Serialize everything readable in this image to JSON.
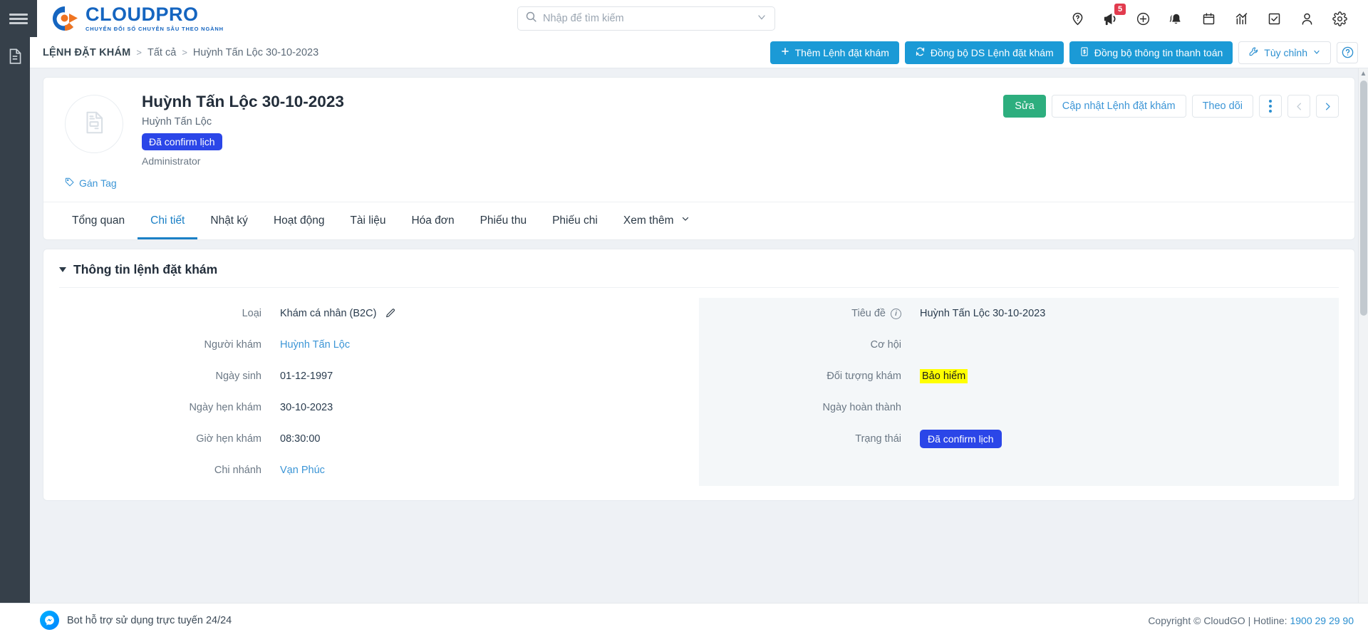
{
  "topbar": {
    "menu_icon": "hamburger-menu-icon",
    "logo_name": "CLOUDPRO",
    "logo_tagline": "CHUYỂN ĐỔI SỐ CHUYÊN SÂU THEO NGÀNH",
    "search_placeholder": "Nhập để tìm kiếm",
    "search_value": "",
    "icons": [
      {
        "name": "location-question-icon",
        "badge": null
      },
      {
        "name": "megaphone-icon",
        "badge": "5"
      },
      {
        "name": "plus-circle-icon",
        "badge": null
      },
      {
        "name": "bell-icon",
        "badge": null
      },
      {
        "name": "calendar-icon",
        "badge": null
      },
      {
        "name": "analytics-chart-icon",
        "badge": null
      },
      {
        "name": "checkbox-task-icon",
        "badge": null
      },
      {
        "name": "user-icon",
        "badge": null
      },
      {
        "name": "gear-icon",
        "badge": null
      }
    ]
  },
  "leftrail": {
    "top_icon": "document-page-icon"
  },
  "subheader": {
    "breadcrumb": {
      "root": "LỆNH ĐẶT KHÁM",
      "separator": ">",
      "mid": "Tất cả",
      "current": "Huỳnh Tấn Lộc 30-10-2023"
    },
    "buttons": [
      {
        "label": "Thêm Lệnh đặt khám",
        "icon": "plus-icon",
        "style": "primary"
      },
      {
        "label": "Đồng bộ DS Lệnh đặt khám",
        "icon": "sync-icon",
        "style": "primary"
      },
      {
        "label": "Đồng bộ thông tin thanh toán",
        "icon": "invoice-icon",
        "style": "primary"
      },
      {
        "label": "Tùy chỉnh",
        "icon": "wrench-icon",
        "style": "ghost"
      }
    ],
    "help_icon": "question-circle-icon"
  },
  "record": {
    "avatar_icon": "document-record-icon",
    "title": "Huỳnh Tấn Lộc 30-10-2023",
    "subtitle": "Huỳnh Tấn Lộc",
    "status_pill": "Đã confirm lịch",
    "owner": "Administrator",
    "tag_label": "Gán Tag",
    "tag_icon": "tag-icon",
    "actions": {
      "edit": "Sửa",
      "update": "Cập nhật Lệnh đặt khám",
      "follow": "Theo dõi",
      "more_icon": "vertical-dots-icon",
      "prev_icon": "chevron-left-icon",
      "next_icon": "chevron-right-icon"
    }
  },
  "tabs": [
    {
      "label": "Tổng quan",
      "active": false
    },
    {
      "label": "Chi tiết",
      "active": true
    },
    {
      "label": "Nhật ký",
      "active": false
    },
    {
      "label": "Hoạt động",
      "active": false
    },
    {
      "label": "Tài liệu",
      "active": false
    },
    {
      "label": "Hóa đơn",
      "active": false
    },
    {
      "label": "Phiếu thu",
      "active": false
    },
    {
      "label": "Phiếu chi",
      "active": false
    },
    {
      "label": "Xem thêm",
      "active": false,
      "icon": "chevron-down-icon"
    }
  ],
  "section": {
    "title": "Thông tin lệnh đặt khám",
    "collapse_icon": "caret-down-icon",
    "left_fields": [
      {
        "label": "Loại",
        "value": "Khám cá nhân (B2C)",
        "type": "text-edit",
        "edit_icon": "pencil-icon"
      },
      {
        "label": "Người khám",
        "value": "Huỳnh Tấn Lộc",
        "type": "link"
      },
      {
        "label": "Ngày sinh",
        "value": "01-12-1997",
        "type": "text"
      },
      {
        "label": "Ngày hẹn khám",
        "value": "30-10-2023",
        "type": "text"
      },
      {
        "label": "Giờ hẹn khám",
        "value": "08:30:00",
        "type": "text"
      },
      {
        "label": "Chi nhánh",
        "value": "Vạn Phúc",
        "type": "link"
      }
    ],
    "right_fields": [
      {
        "label": "Tiêu đề",
        "value": "Huỳnh Tấn Lộc 30-10-2023",
        "type": "text",
        "info_icon": "info-icon"
      },
      {
        "label": "Cơ hội",
        "value": "",
        "type": "text"
      },
      {
        "label": "Đối tượng khám",
        "value": "Bảo hiểm",
        "type": "highlight"
      },
      {
        "label": "Ngày hoàn thành",
        "value": "",
        "type": "text"
      },
      {
        "label": "Trạng thái",
        "value": "Đã confirm lịch",
        "type": "pill"
      }
    ]
  },
  "footer": {
    "bot_icon": "messenger-icon",
    "bot_label": "Bot hỗ trợ sử dụng trực tuyến 24/24",
    "copyright": "Copyright © CloudGO | Hotline: ",
    "hotline": "1900 29 29 90"
  },
  "colors": {
    "primary_blue": "#1b9ad6",
    "link_blue": "#3b95d6",
    "green": "#2dae7e",
    "pill_blue": "#2b46e8",
    "highlight_yellow": "#ffff00",
    "badge_red": "#e23b4e",
    "rail_dark": "#36404a"
  }
}
